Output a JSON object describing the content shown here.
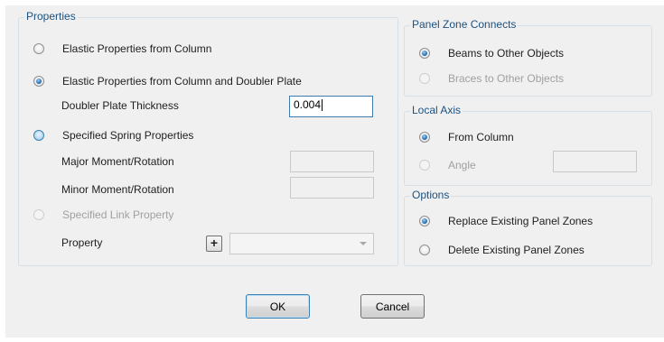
{
  "properties": {
    "title": "Properties",
    "elastic_column_label": "Elastic Properties from Column",
    "elastic_column_doubler_label": "Elastic Properties from Column and Doubler Plate",
    "doubler_thickness_label": "Doubler Plate Thickness",
    "doubler_thickness_value": "0.004",
    "specified_spring_label": "Specified Spring Properties",
    "major_moment_label": "Major Moment/Rotation",
    "major_moment_value": "",
    "minor_moment_label": "Minor Moment/Rotation",
    "minor_moment_value": "",
    "specified_link_label": "Specified Link Property",
    "property_label": "Property",
    "add_property_symbol": "+",
    "property_value": ""
  },
  "panel_zone_connects": {
    "title": "Panel Zone Connects",
    "beams_label": "Beams to Other Objects",
    "braces_label": "Braces to Other Objects"
  },
  "local_axis": {
    "title": "Local Axis",
    "from_column_label": "From Column",
    "angle_label": "Angle",
    "angle_value": ""
  },
  "options": {
    "title": "Options",
    "replace_label": "Replace Existing Panel Zones",
    "delete_label": "Delete Existing Panel Zones"
  },
  "buttons": {
    "ok_label": "OK",
    "cancel_label": "Cancel"
  },
  "colors": {
    "group_title": "#1c5180",
    "accent": "#3c7fb1"
  }
}
